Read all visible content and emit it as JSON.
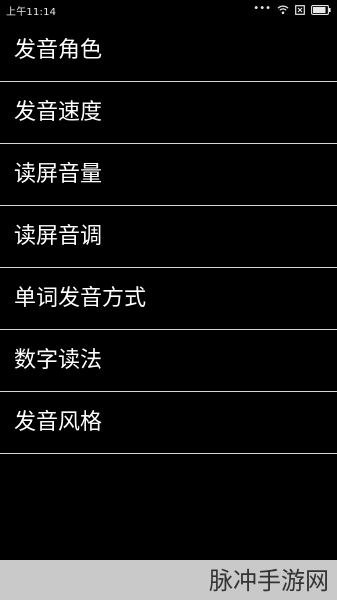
{
  "status_bar": {
    "time": "上午11:14",
    "more_dots": "•••"
  },
  "menu": {
    "items": [
      {
        "label": "发音角色"
      },
      {
        "label": "发音速度"
      },
      {
        "label": "读屏音量"
      },
      {
        "label": "读屏音调"
      },
      {
        "label": "单词发音方式"
      },
      {
        "label": "数字读法"
      },
      {
        "label": "发音风格"
      }
    ]
  },
  "watermark": {
    "text": "脉冲手游网"
  },
  "colors": {
    "background": "#000000",
    "text": "#ffffff",
    "divider": "#d6d6d6",
    "footer": "#c9c9c9"
  },
  "icons": {
    "status": [
      "wifi-icon",
      "notification-icon",
      "battery-icon"
    ]
  }
}
